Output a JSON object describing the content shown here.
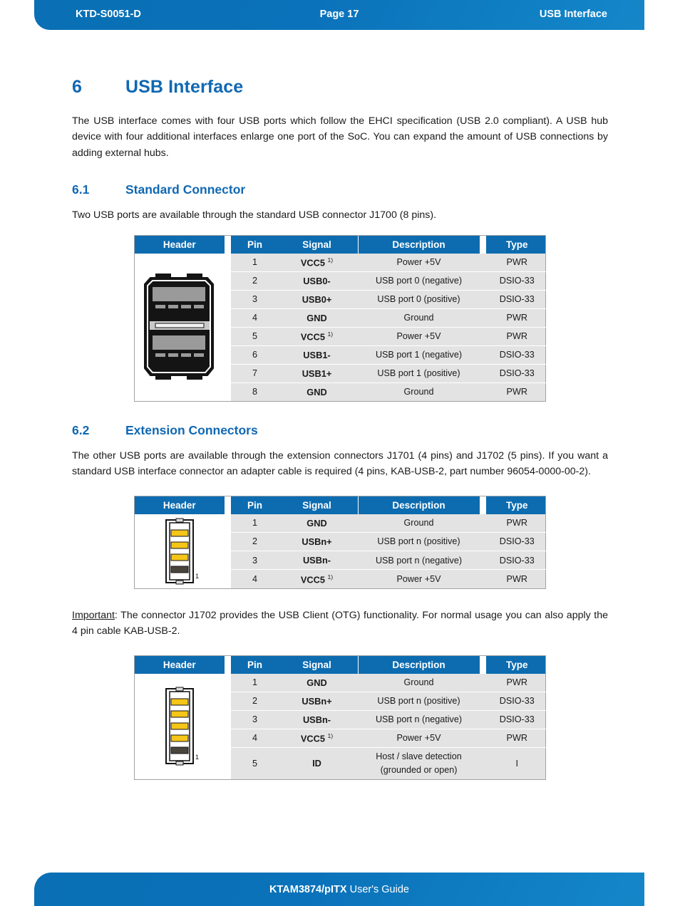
{
  "header": {
    "doc_id": "KTD-S0051-D",
    "page": "Page 17",
    "section": "USB Interface"
  },
  "footer": {
    "product": "KTAM3874/pITX",
    "suffix": " User's Guide"
  },
  "chapter": {
    "number": "6",
    "title": "USB Interface",
    "intro": "The USB interface comes with four USB ports which follow the EHCI specification (USB 2.0 compliant). A USB hub device with four additional interfaces enlarge one port of the SoC. You can expand the amount of USB connections by adding external hubs."
  },
  "section_61": {
    "number": "6.1",
    "title": "Standard Connector",
    "intro": "Two USB ports are available through the standard USB connector J1700 (8 pins)."
  },
  "section_62": {
    "number": "6.2",
    "title": "Extension Connectors",
    "intro": "The other USB ports are available through the extension connectors J1701 (4 pins) and J1702 (5 pins). If you want a standard USB interface connector an adapter cable is required (4 pins, KAB-USB-2, part number 96054-0000-00-2).",
    "important_label": "Important",
    "important_text": ": The connector J1702 provides the USB Client (OTG) functionality. For normal usage you can also apply the 4 pin cable KAB-USB-2."
  },
  "table_columns": {
    "header": "Header",
    "pin": "Pin",
    "signal": "Signal",
    "description": "Description",
    "type": "Type"
  },
  "table_j1700": {
    "connector_icon": "usb-type-a-dual-stacked-icon",
    "rows": [
      {
        "pin": "1",
        "signal": "VCC5",
        "sup": "1)",
        "description": "Power +5V",
        "type": "PWR"
      },
      {
        "pin": "2",
        "signal": "USB0-",
        "sup": "",
        "description": "USB port 0 (negative)",
        "type": "DSIO-33"
      },
      {
        "pin": "3",
        "signal": "USB0+",
        "sup": "",
        "description": "USB port 0 (positive)",
        "type": "DSIO-33"
      },
      {
        "pin": "4",
        "signal": "GND",
        "sup": "",
        "description": "Ground",
        "type": "PWR"
      },
      {
        "pin": "5",
        "signal": "VCC5",
        "sup": "1)",
        "description": "Power +5V",
        "type": "PWR"
      },
      {
        "pin": "6",
        "signal": "USB1-",
        "sup": "",
        "description": "USB port 1 (negative)",
        "type": "DSIO-33"
      },
      {
        "pin": "7",
        "signal": "USB1+",
        "sup": "",
        "description": "USB port 1 (positive)",
        "type": "DSIO-33"
      },
      {
        "pin": "8",
        "signal": "GND",
        "sup": "",
        "description": "Ground",
        "type": "PWR"
      }
    ]
  },
  "table_j1701": {
    "connector_icon": "pin-header-4pin-icon",
    "pin1_label": "1",
    "rows": [
      {
        "pin": "1",
        "signal": "GND",
        "sup": "",
        "description": "Ground",
        "type": "PWR"
      },
      {
        "pin": "2",
        "signal": "USBn+",
        "sup": "",
        "description": "USB port n (positive)",
        "type": "DSIO-33"
      },
      {
        "pin": "3",
        "signal": "USBn-",
        "sup": "",
        "description": "USB port n (negative)",
        "type": "DSIO-33"
      },
      {
        "pin": "4",
        "signal": "VCC5",
        "sup": "1)",
        "description": "Power +5V",
        "type": "PWR"
      }
    ]
  },
  "table_j1702": {
    "connector_icon": "pin-header-5pin-icon",
    "pin1_label": "1",
    "rows": [
      {
        "pin": "1",
        "signal": "GND",
        "sup": "",
        "description": "Ground",
        "type": "PWR"
      },
      {
        "pin": "2",
        "signal": "USBn+",
        "sup": "",
        "description": "USB port n (positive)",
        "type": "DSIO-33"
      },
      {
        "pin": "3",
        "signal": "USBn-",
        "sup": "",
        "description": "USB port n (negative)",
        "type": "DSIO-33"
      },
      {
        "pin": "4",
        "signal": "VCC5",
        "sup": "1)",
        "description": "Power +5V",
        "type": "PWR"
      },
      {
        "pin": "5",
        "signal": "ID",
        "sup": "",
        "description_line1": "Host / slave detection",
        "description_line2": "(grounded or open)",
        "type": "I"
      }
    ]
  },
  "colors": {
    "brand_blue": "#0a72ba",
    "table_header_blue": "#0d6cb0",
    "heading_blue": "#1068b3",
    "row_gray": "#e3e3e3",
    "pin_yellow": "#f5c518"
  }
}
